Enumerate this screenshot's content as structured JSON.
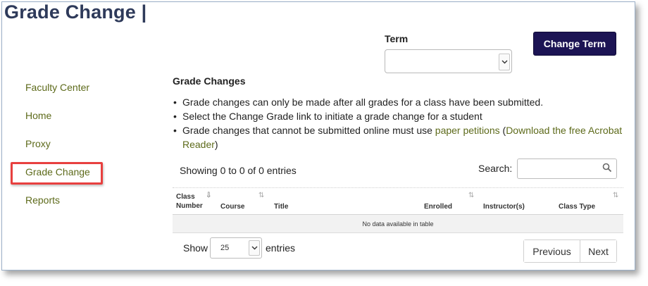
{
  "header": {
    "title": "Grade Change |"
  },
  "term": {
    "label": "Term",
    "selected": "",
    "change_button": "Change Term"
  },
  "sidebar": {
    "items": [
      {
        "label": "Faculty Center"
      },
      {
        "label": "Home"
      },
      {
        "label": "Proxy"
      },
      {
        "label": "Grade Change",
        "highlighted": true
      },
      {
        "label": "Reports"
      }
    ]
  },
  "main": {
    "section_title": "Grade Changes",
    "bullet_char": "•",
    "bullets": {
      "b1": "Grade changes can only be made after all grades for a class have been submitted.",
      "b2": "Select the Change Grade link to initiate a grade change for a student",
      "b3_prefix": "Grade changes that cannot be submitted online must use ",
      "b3_link1": "paper petitions",
      "b3_open": " (",
      "b3_link2": "Download the free Acrobat Reader",
      "b3_close": ")"
    }
  },
  "table": {
    "info": "Showing 0 to 0 of 0 entries",
    "search_label": "Search:",
    "search_value": "",
    "columns": {
      "class_number_1": "Class",
      "class_number_2": "Number",
      "course": "Course",
      "title": "Title",
      "enrolled": "Enrolled",
      "instructors": "Instructor(s)",
      "class_type": "Class Type"
    },
    "sort_glyph": "⇅",
    "sort_active_glyph": "⇩",
    "empty_message": "No data available in table",
    "show_label": "Show",
    "page_length": "25",
    "entries_label": "entries",
    "pagination": {
      "previous": "Previous",
      "next": "Next"
    }
  },
  "colors": {
    "title": "#2e3a5a",
    "button_bg": "#1c1454",
    "link": "#5d6a1a",
    "highlight": "#e8403f"
  },
  "icons": {
    "search": "search-icon",
    "dropdown": "chevron-down-icon",
    "sort": "sort-icon"
  }
}
